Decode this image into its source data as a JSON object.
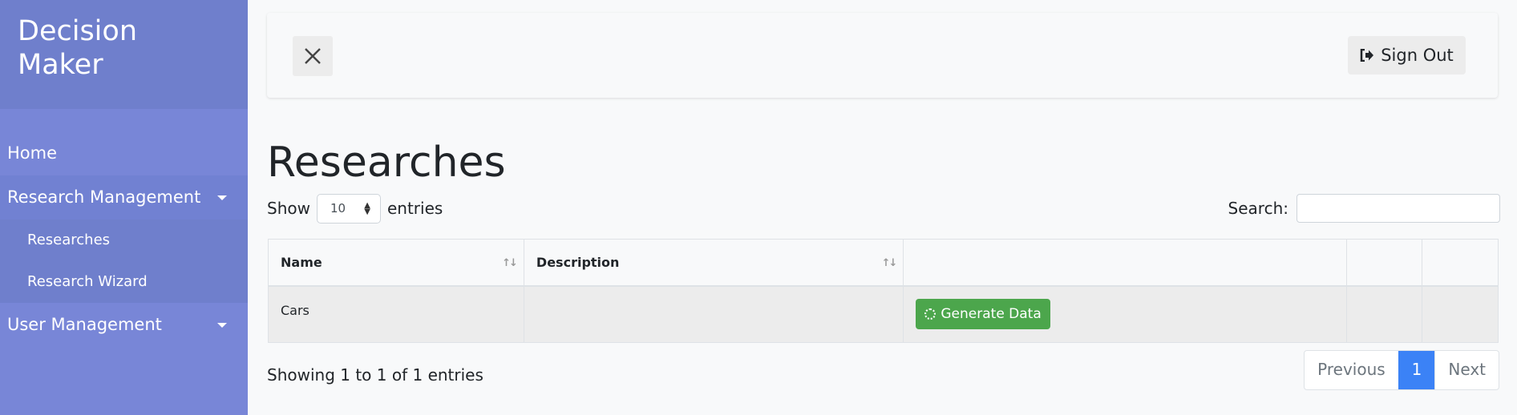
{
  "sidebar": {
    "brand": "Decision Maker",
    "items": [
      {
        "label": "Home"
      },
      {
        "label": "Research Management",
        "submenu": [
          {
            "label": "Researches"
          },
          {
            "label": "Research Wizard"
          }
        ]
      },
      {
        "label": "User Management"
      }
    ]
  },
  "topbar": {
    "close_icon": "close-icon",
    "signout_label": "Sign Out",
    "signout_icon": "sign-out-icon"
  },
  "main": {
    "title": "Researches",
    "length": {
      "prefix": "Show",
      "value": "10",
      "suffix": "entries"
    },
    "search": {
      "label": "Search:",
      "value": ""
    },
    "table": {
      "headers": [
        "Name",
        "Description",
        "",
        "",
        ""
      ],
      "rows": [
        {
          "name": "Cars",
          "description": "",
          "action_label": "Generate Data"
        }
      ]
    },
    "info": "Showing 1 to 1 of 1 entries",
    "pagination": {
      "previous": "Previous",
      "current": "1",
      "next": "Next"
    }
  },
  "colors": {
    "sidebar": "#7886d7",
    "sidebar_header": "#6f7fcc",
    "generate_button": "#4ca64c",
    "active_page": "#3b82f6"
  }
}
